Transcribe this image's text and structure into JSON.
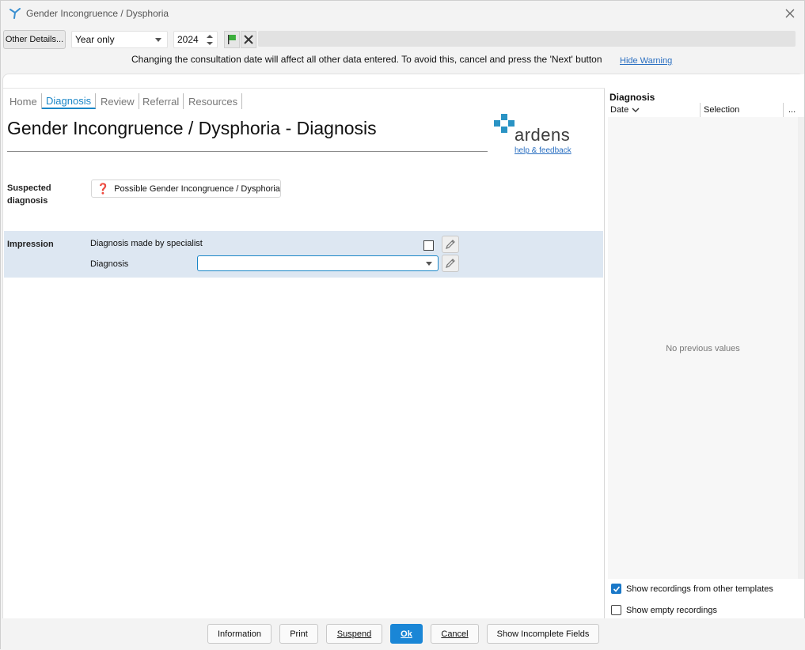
{
  "window": {
    "title": "Gender Incongruence / Dysphoria"
  },
  "toolbar": {
    "other_details_label": "Other Details...",
    "period_value": "Year only",
    "year_value": "2024"
  },
  "warning": {
    "text": "Changing the consultation date will affect all other data entered. To avoid this, cancel and press the 'Next' button",
    "hide_label": "Hide Warning"
  },
  "tabs": [
    {
      "label": "Home"
    },
    {
      "label": "Diagnosis"
    },
    {
      "label": "Review"
    },
    {
      "label": "Referral"
    },
    {
      "label": "Resources"
    }
  ],
  "page": {
    "title": "Gender Incongruence / Dysphoria - Diagnosis",
    "logo_text": "ardens",
    "help_link": "help & feedback",
    "suspected_label": "Suspected diagnosis",
    "suspected_value": "Possible Gender Incongruence / Dysphoria",
    "impression_label": "Impression",
    "specialist_label": "Diagnosis made by specialist",
    "diagnosis_label": "Diagnosis"
  },
  "right_panel": {
    "title": "Diagnosis",
    "col_date": "Date",
    "col_selection": "Selection",
    "col_more": "...",
    "empty_text": "No previous values",
    "opt_other_templates": "Show recordings from other templates",
    "opt_empty": "Show empty recordings"
  },
  "footer": {
    "information": "Information",
    "print": "Print",
    "suspend": "Suspend",
    "ok": "Ok",
    "cancel": "Cancel",
    "show_incomplete": "Show Incomplete Fields"
  },
  "colors": {
    "accent": "#1a86c7",
    "impression_band": "#dde7f2",
    "logo": "#2a93c4"
  }
}
